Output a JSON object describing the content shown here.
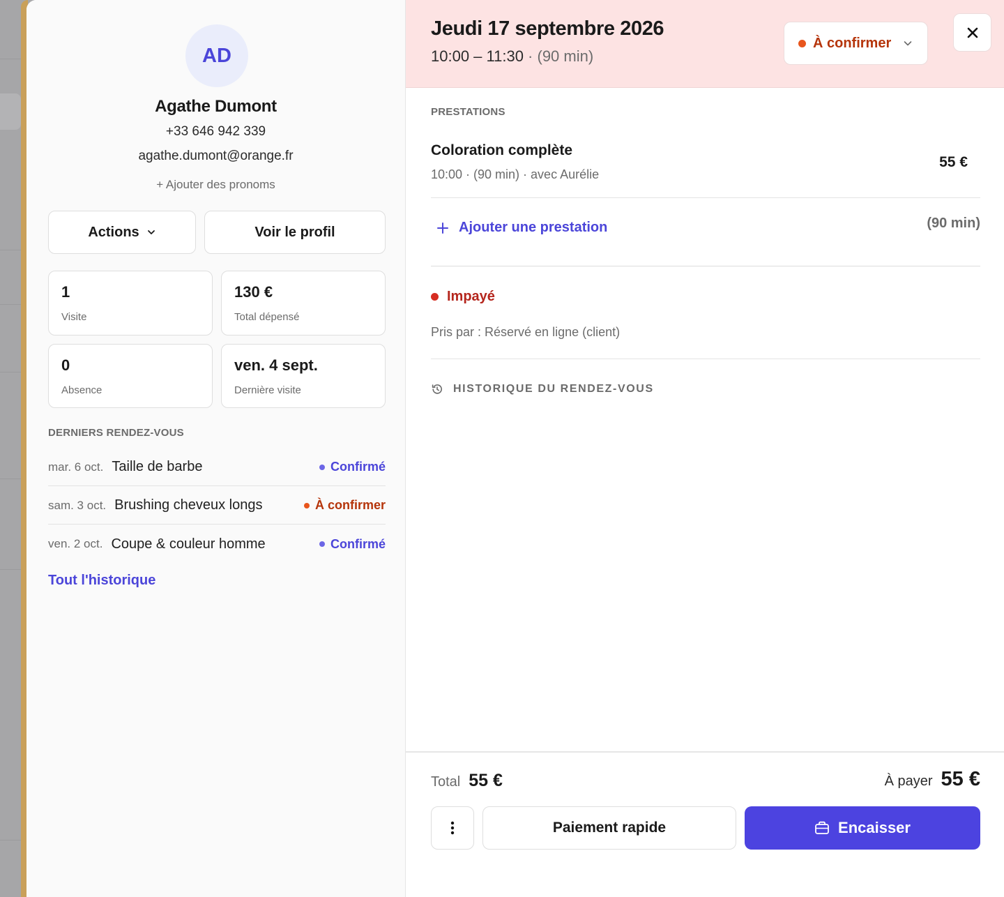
{
  "colors": {
    "accent": "#4b45d9",
    "primary_button": "#4c43e0",
    "header_bg": "#fde3e3",
    "pending_orange": "#e8551c",
    "pending_text": "#b5340a",
    "unpaid_red": "#d62d22"
  },
  "client": {
    "initials": "AD",
    "name": "Agathe Dumont",
    "phone": "+33 646 942 339",
    "email": "agathe.dumont@orange.fr",
    "add_pronouns": "+ Ajouter des pronoms",
    "actions_label": "Actions",
    "profile_label": "Voir le profil",
    "stats": [
      {
        "value": "1",
        "label": "Visite"
      },
      {
        "value": "130 €",
        "label": "Total dépensé"
      },
      {
        "value": "0",
        "label": "Absence"
      },
      {
        "value": "ven. 4 sept.",
        "label": "Dernière visite"
      }
    ],
    "recent_title": "DERNIERS RENDEZ-VOUS",
    "recent": [
      {
        "date": "mar. 6 oct.",
        "service": "Taille de barbe",
        "status": "Confirmé",
        "status_color": "#4b45d9",
        "dot_color": "#6c66e6"
      },
      {
        "date": "sam. 3 oct.",
        "service": "Brushing cheveux longs",
        "status": "À confirmer",
        "status_color": "#b5340a",
        "dot_color": "#e8551c"
      },
      {
        "date": "ven. 2 oct.",
        "service": "Coupe & couleur homme",
        "status": "Confirmé",
        "status_color": "#4b45d9",
        "dot_color": "#6c66e6"
      }
    ],
    "all_history": "Tout l'historique"
  },
  "appointment": {
    "title": "Jeudi 17 septembre 2026",
    "time": "10:00 – 11:30",
    "separator": " · ",
    "duration": "(90 min)",
    "status": "À confirmer",
    "services_label": "PRESTATIONS",
    "service": {
      "name": "Coloration complète",
      "details": "10:00 · (90 min) · avec Aurélie",
      "price": "55 €"
    },
    "add_service": "Ajouter une prestation",
    "add_service_duration": "(90 min)",
    "payment_status": "Impayé",
    "taken_by": "Pris par : Réservé en ligne (client)",
    "history_label": "HISTORIQUE DU RENDEZ-VOUS"
  },
  "footer": {
    "total_label": "Total",
    "total_value": "55 €",
    "to_pay_label": "À payer",
    "to_pay_value": "55 €",
    "quick_pay": "Paiement rapide",
    "cash_in": "Encaisser"
  },
  "icons": [
    "chevron-down-icon",
    "close-icon",
    "plus-icon",
    "history-icon",
    "more-vertical-icon",
    "wallet-icon"
  ]
}
